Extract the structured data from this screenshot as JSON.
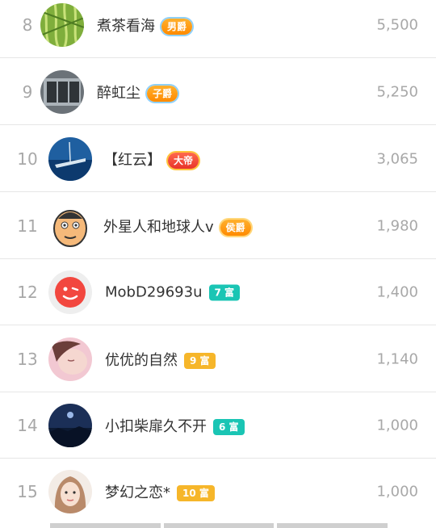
{
  "leaderboard": [
    {
      "rank": "8",
      "name": "煮茶看海",
      "badge": "男爵",
      "badge_type": "noble-blue",
      "score": "5,500"
    },
    {
      "rank": "9",
      "name": "醉虹尘",
      "badge": "子爵",
      "badge_type": "noble-blue",
      "score": "5,250"
    },
    {
      "rank": "10",
      "name": "【红云】",
      "badge": "大帝",
      "badge_type": "emperor",
      "score": "3,065"
    },
    {
      "rank": "11",
      "name": "外星人和地球人v",
      "badge": "侯爵",
      "badge_type": "noble",
      "score": "1,980"
    },
    {
      "rank": "12",
      "name": "MobD29693u",
      "badge": "7 富",
      "badge_type": "rich-teal",
      "score": "1,400"
    },
    {
      "rank": "13",
      "name": "优优的自然",
      "badge": "9 富",
      "badge_type": "rich-orange",
      "score": "1,140"
    },
    {
      "rank": "14",
      "name": "小扣柴扉久不开",
      "badge": "6 富",
      "badge_type": "rich-teal",
      "score": "1,000"
    },
    {
      "rank": "15",
      "name": "梦幻之恋*",
      "badge": "10 富",
      "badge_type": "rich-orange",
      "score": "1,000"
    }
  ],
  "colors": {
    "rank": "#a8a8a8",
    "name": "#333333",
    "teal": "#1ac5b4",
    "orange": "#f6b62a",
    "separator": "#e6e6e6"
  }
}
